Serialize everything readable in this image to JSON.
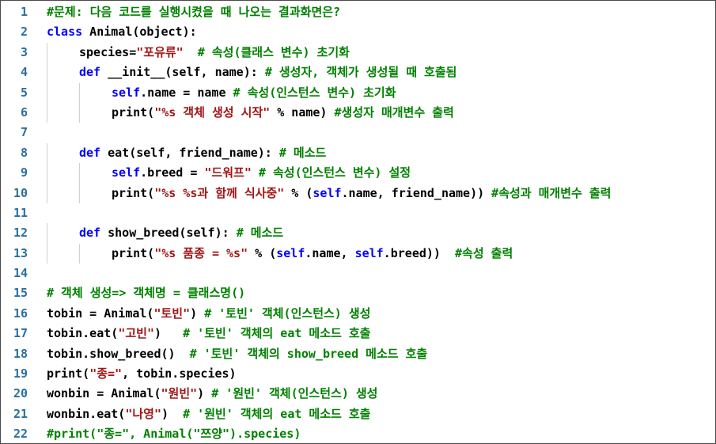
{
  "editor": {
    "lines": [
      {
        "n": "1",
        "indent": 0,
        "tokens": [
          {
            "t": "cm",
            "v": "#문제: 다음 코드를 실행시켰을 때 나오는 결과화면은?"
          }
        ]
      },
      {
        "n": "2",
        "indent": 0,
        "tokens": [
          {
            "t": "kw",
            "v": "class"
          },
          {
            "t": "id",
            "v": " Animal(object):"
          }
        ]
      },
      {
        "n": "3",
        "indent": 1,
        "tokens": [
          {
            "t": "id",
            "v": "species="
          },
          {
            "t": "str",
            "v": "\"포유류\""
          },
          {
            "t": "cm",
            "v": "  # 속성(클래스 변수) 초기화"
          }
        ]
      },
      {
        "n": "4",
        "indent": 1,
        "tokens": [
          {
            "t": "kw",
            "v": "def"
          },
          {
            "t": "id",
            "v": " __init__(self, name): "
          },
          {
            "t": "cm",
            "v": "# 생성자, 객체가 생성될 때 호출됨"
          }
        ]
      },
      {
        "n": "5",
        "indent": 2,
        "tokens": [
          {
            "t": "slf",
            "v": "self"
          },
          {
            "t": "id",
            "v": ".name = name "
          },
          {
            "t": "cm",
            "v": "# 속성(인스턴스 변수) 초기화"
          }
        ]
      },
      {
        "n": "6",
        "indent": 2,
        "tokens": [
          {
            "t": "id",
            "v": "print("
          },
          {
            "t": "str",
            "v": "\"%s 객체 생성 시작\""
          },
          {
            "t": "id",
            "v": " % name) "
          },
          {
            "t": "cm",
            "v": "#생성자 매개변수 출력"
          }
        ]
      },
      {
        "n": "7",
        "indent": 0,
        "tokens": []
      },
      {
        "n": "8",
        "indent": 1,
        "tokens": [
          {
            "t": "kw",
            "v": "def"
          },
          {
            "t": "id",
            "v": " eat(self, friend_name): "
          },
          {
            "t": "cm",
            "v": "# 메소드"
          }
        ]
      },
      {
        "n": "9",
        "indent": 2,
        "tokens": [
          {
            "t": "slf",
            "v": "self"
          },
          {
            "t": "id",
            "v": ".breed = "
          },
          {
            "t": "str",
            "v": "\"드워프\""
          },
          {
            "t": "cm",
            "v": " # 속성(인스턴스 변수) 설정"
          }
        ]
      },
      {
        "n": "10",
        "indent": 2,
        "tokens": [
          {
            "t": "id",
            "v": "print("
          },
          {
            "t": "str",
            "v": "\"%s %s과 함께 식사중\""
          },
          {
            "t": "id",
            "v": " % ("
          },
          {
            "t": "slf",
            "v": "self"
          },
          {
            "t": "id",
            "v": ".name, friend_name)) "
          },
          {
            "t": "cm",
            "v": "#속성과 매개변수 출력"
          }
        ]
      },
      {
        "n": "11",
        "indent": 0,
        "tokens": []
      },
      {
        "n": "12",
        "indent": 1,
        "tokens": [
          {
            "t": "kw",
            "v": "def"
          },
          {
            "t": "id",
            "v": " show_breed(self): "
          },
          {
            "t": "cm",
            "v": "# 메소드"
          }
        ]
      },
      {
        "n": "13",
        "indent": 2,
        "tokens": [
          {
            "t": "id",
            "v": "print("
          },
          {
            "t": "str",
            "v": "\"%s 품종 = %s\""
          },
          {
            "t": "id",
            "v": " % ("
          },
          {
            "t": "slf",
            "v": "self"
          },
          {
            "t": "id",
            "v": ".name, "
          },
          {
            "t": "slf",
            "v": "self"
          },
          {
            "t": "id",
            "v": ".breed))  "
          },
          {
            "t": "cm",
            "v": "#속성 출력"
          }
        ]
      },
      {
        "n": "14",
        "indent": 0,
        "tokens": []
      },
      {
        "n": "15",
        "indent": 0,
        "tokens": [
          {
            "t": "cm",
            "v": "# 객체 생성=> 객체명 = 클래스명()"
          }
        ]
      },
      {
        "n": "16",
        "indent": 0,
        "tokens": [
          {
            "t": "id",
            "v": "tobin = Animal("
          },
          {
            "t": "str",
            "v": "\"토빈\""
          },
          {
            "t": "id",
            "v": ") "
          },
          {
            "t": "cm",
            "v": "# '토빈' 객체(인스턴스) 생성"
          }
        ]
      },
      {
        "n": "17",
        "indent": 0,
        "tokens": [
          {
            "t": "id",
            "v": "tobin.eat("
          },
          {
            "t": "str",
            "v": "\"고빈\""
          },
          {
            "t": "id",
            "v": ")   "
          },
          {
            "t": "cm",
            "v": "# '토빈' 객체의 eat 메소드 호출"
          }
        ]
      },
      {
        "n": "18",
        "indent": 0,
        "tokens": [
          {
            "t": "id",
            "v": "tobin.show_breed()  "
          },
          {
            "t": "cm",
            "v": "# '토빈' 객체의 show_breed 메소드 호출"
          }
        ]
      },
      {
        "n": "19",
        "indent": 0,
        "tokens": [
          {
            "t": "id",
            "v": "print("
          },
          {
            "t": "str",
            "v": "\"종=\""
          },
          {
            "t": "id",
            "v": ", tobin.species)"
          }
        ]
      },
      {
        "n": "20",
        "indent": 0,
        "tokens": [
          {
            "t": "id",
            "v": "wonbin = Animal("
          },
          {
            "t": "str",
            "v": "\"원빈\""
          },
          {
            "t": "id",
            "v": ") "
          },
          {
            "t": "cm",
            "v": "# '원빈' 객체(인스턴스) 생성"
          }
        ]
      },
      {
        "n": "21",
        "indent": 0,
        "tokens": [
          {
            "t": "id",
            "v": "wonbin.eat("
          },
          {
            "t": "str",
            "v": "\"나영\""
          },
          {
            "t": "id",
            "v": ")  "
          },
          {
            "t": "cm",
            "v": "# '원빈' 객체의 eat 메소드 호출"
          }
        ]
      },
      {
        "n": "22",
        "indent": 0,
        "tokens": [
          {
            "t": "cm",
            "v": "#print(\"종=\", Animal(\"쯔양\").species)"
          }
        ]
      }
    ]
  },
  "colors": {
    "keyword": "#0000ff",
    "string": "#a31515",
    "comment": "#008000",
    "line_number": "#2b6f9e",
    "border": "#4a4a4a"
  }
}
